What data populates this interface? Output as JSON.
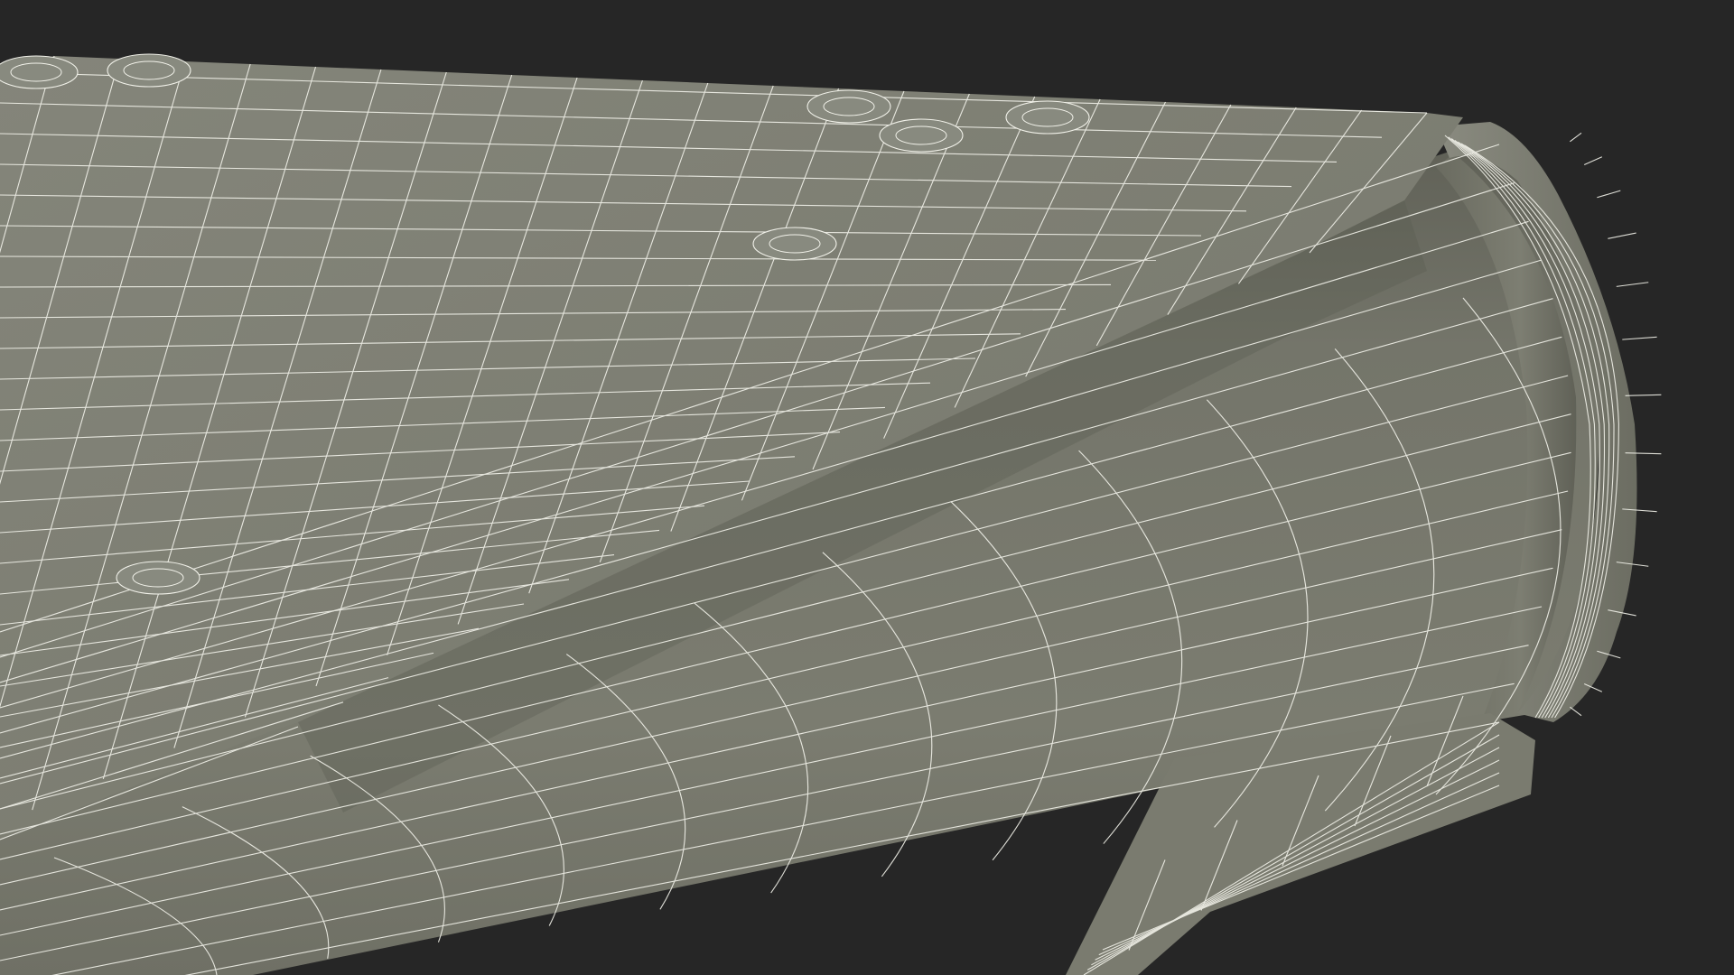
{
  "viewport": {
    "subject": "wireframe-3d-model",
    "shading": "solid-with-wireframe-overlay"
  },
  "colors": {
    "background": "#262626",
    "surface_light": "#7e7f72",
    "surface_mid": "#75766a",
    "surface_dark": "#5f6055",
    "shadow": "#4e4f46",
    "wire": "#f2f2ea"
  }
}
